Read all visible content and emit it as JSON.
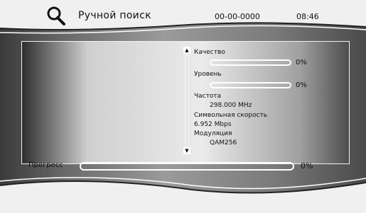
{
  "header": {
    "title": "Ручной поиск",
    "date": "00-00-0000",
    "time": "08:46",
    "icon": "search-icon"
  },
  "info": {
    "quality_label": "Качество",
    "quality_value": 0,
    "quality_pct": "0%",
    "level_label": "Уровень",
    "level_value": 0,
    "level_pct": "0%",
    "frequency_label": "Частота",
    "frequency_value": "298.000 MHz",
    "symbol_rate_label": "Символьная скорость",
    "symbol_rate_value": "6.952 Mbps",
    "modulation_label": "Модуляция",
    "modulation_value": "QAM256"
  },
  "scrollbar": {
    "up_icon": "triangle-up-icon",
    "down_icon": "triangle-down-icon"
  },
  "progress": {
    "label": "Прогресс",
    "value": 0,
    "pct": "0%"
  },
  "colors": {
    "background": "#8a8a8a",
    "panel": "#e2e2e2",
    "bar_outline": "#ffffff",
    "text": "#111111"
  }
}
